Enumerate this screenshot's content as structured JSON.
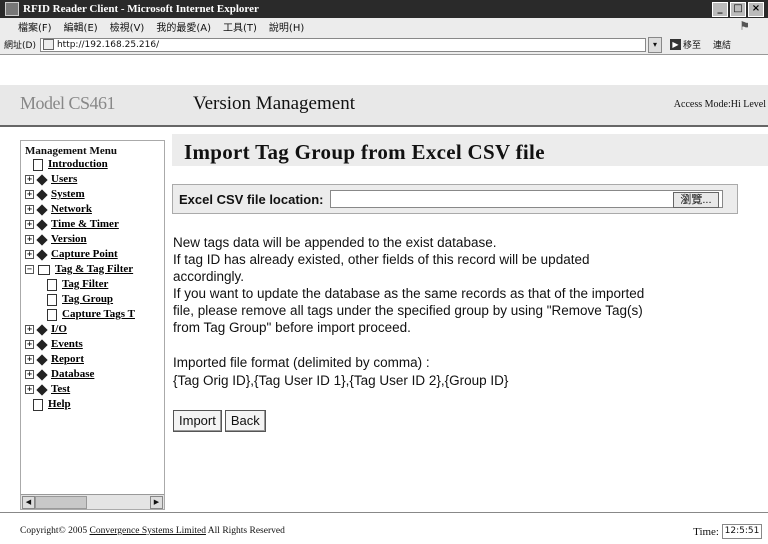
{
  "window": {
    "title": "RFID Reader Client - Microsoft Internet Explorer"
  },
  "menubar": {
    "items": [
      "檔案(F)",
      "編輯(E)",
      "檢視(V)",
      "我的最愛(A)",
      "工具(T)",
      "說明(H)"
    ]
  },
  "addressbar": {
    "label": "網址(D)",
    "url": "http://192.168.25.216/",
    "go_label": "移至",
    "links_label": "連結"
  },
  "header": {
    "model": "Model CS461",
    "section": "Version Management",
    "access": "Access Mode:Hi Level"
  },
  "sidebar": {
    "title": "Management Menu",
    "items": [
      {
        "label": "Introduction",
        "type": "page"
      },
      {
        "label": "Users",
        "type": "book"
      },
      {
        "label": "System",
        "type": "book"
      },
      {
        "label": "Network",
        "type": "book"
      },
      {
        "label": "Time & Timer",
        "type": "book"
      },
      {
        "label": "Version",
        "type": "book"
      },
      {
        "label": "Capture Point",
        "type": "book"
      },
      {
        "label": "Tag & Tag Filter",
        "type": "folder-open"
      },
      {
        "label": "Tag Filter",
        "type": "subpage"
      },
      {
        "label": "Tag Group",
        "type": "subpage"
      },
      {
        "label": "Capture Tags T",
        "type": "subpage"
      },
      {
        "label": "I/O",
        "type": "book"
      },
      {
        "label": "Events",
        "type": "book"
      },
      {
        "label": "Report",
        "type": "book"
      },
      {
        "label": "Database",
        "type": "book"
      },
      {
        "label": "Test",
        "type": "book"
      },
      {
        "label": "Help",
        "type": "page"
      }
    ]
  },
  "main": {
    "title": "Import Tag Group from Excel CSV file",
    "file_label": "Excel CSV file location:",
    "file_value": "",
    "browse_label": "瀏覽...",
    "message_lines": [
      "New tags data will be appended to the exist database.",
      "If tag ID has already existed, other fields of this record will be updated",
      "accordingly.",
      "If you want to update the database as the same records as that of the imported",
      "file, please remove all tags under the specified group by using \"Remove Tag(s)",
      "from Tag Group\" before import proceed."
    ],
    "format_label": "Imported file format (delimited by comma) :",
    "format_value": "{Tag Orig ID},{Tag User ID 1},{Tag User ID 2},{Group ID}",
    "import_button": "Import",
    "back_button": "Back"
  },
  "footer": {
    "copyright_prefix": "Copyright© 2005 ",
    "company": "Convergence Systems Limited",
    "copyright_suffix": "  All Rights Reserved",
    "time_label": "Time:",
    "time_value": "12:5:51"
  }
}
